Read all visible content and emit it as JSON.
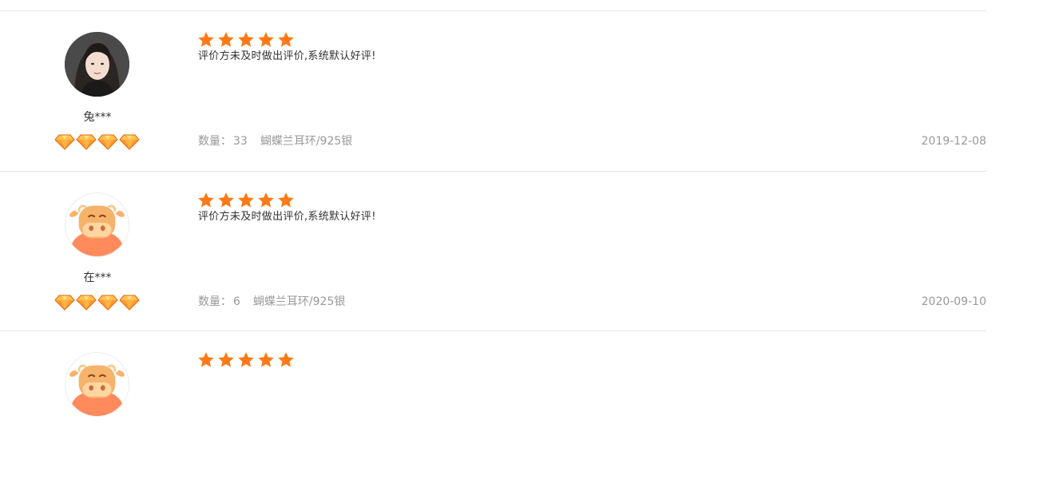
{
  "reviews": [
    {
      "username": "兔***",
      "avatar": "woman-photo-avatar",
      "rating": 5,
      "content": "评价方未及时做出评价,系统默认好评!",
      "quantity_label": "数量：",
      "quantity": "33",
      "spec": "蝴蝶兰耳环/925银",
      "date": "2019-12-08",
      "badges": 4
    },
    {
      "username": "在***",
      "avatar": "cow-cartoon-avatar",
      "rating": 5,
      "content": "评价方未及时做出评价,系统默认好评!",
      "quantity_label": "数量：",
      "quantity": "6",
      "spec": "蝴蝶兰耳环/925银",
      "date": "2020-09-10",
      "badges": 4
    },
    {
      "avatar": "cow-cartoon-avatar",
      "rating": 5
    }
  ],
  "colors": {
    "star": "#ff7a16",
    "badge": "#ff8a1a",
    "divider": "#e5e5e5",
    "muted_text": "#999999",
    "body_text": "#333333"
  }
}
